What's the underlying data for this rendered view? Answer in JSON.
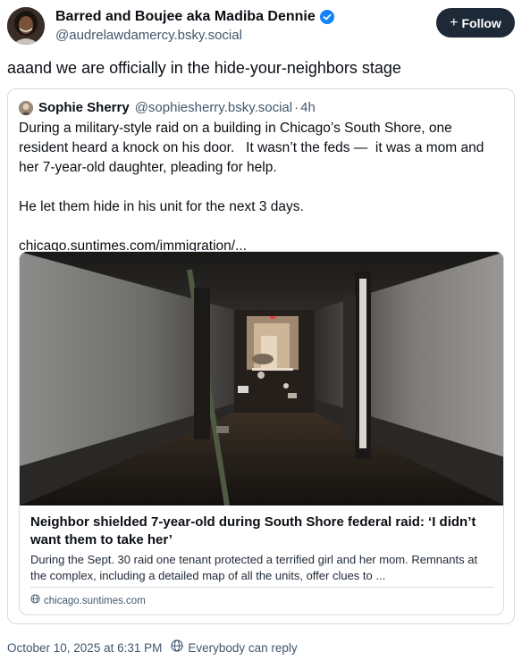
{
  "author": {
    "display_name": "Barred and Boujee aka Madiba Dennie",
    "handle": "@audrelawdamercy.bsky.social",
    "verified": true,
    "verified_color": "#1083fe"
  },
  "follow_button": {
    "label": "Follow",
    "icon": "plus-icon"
  },
  "post": {
    "text": "aaand we are officially in the hide-your-neighbors stage"
  },
  "quote": {
    "display_name": "Sophie Sherry",
    "handle": "@sophiesherry.bsky.social",
    "separator": "·",
    "age": "4h",
    "body": "During a military-style raid on a building in Chicago’s South Shore, one resident heard a knock on his door.   It wasn’t the feds —  it was a mom and her 7-year-old daughter, pleading for help.\n\nHe let them hide in his unit for the next 3 days.\n\nchicago.suntimes.com/immigration/...",
    "link_card": {
      "image_description_icon": "hallway-photo",
      "title": "Neighbor shielded 7-year-old during South Shore federal raid: ‘I didn’t want them to take her’",
      "description": "During the Sept. 30 raid one tenant protected a terrified girl and her mom. Remnants at the complex, including a detailed map of all the units, offer clues to ...",
      "domain": "chicago.suntimes.com",
      "domain_icon": "globe-icon"
    }
  },
  "footer": {
    "timestamp": "October 10, 2025 at 6:31 PM",
    "reply_setting": "Everybody can reply",
    "reply_icon": "globe-icon"
  }
}
